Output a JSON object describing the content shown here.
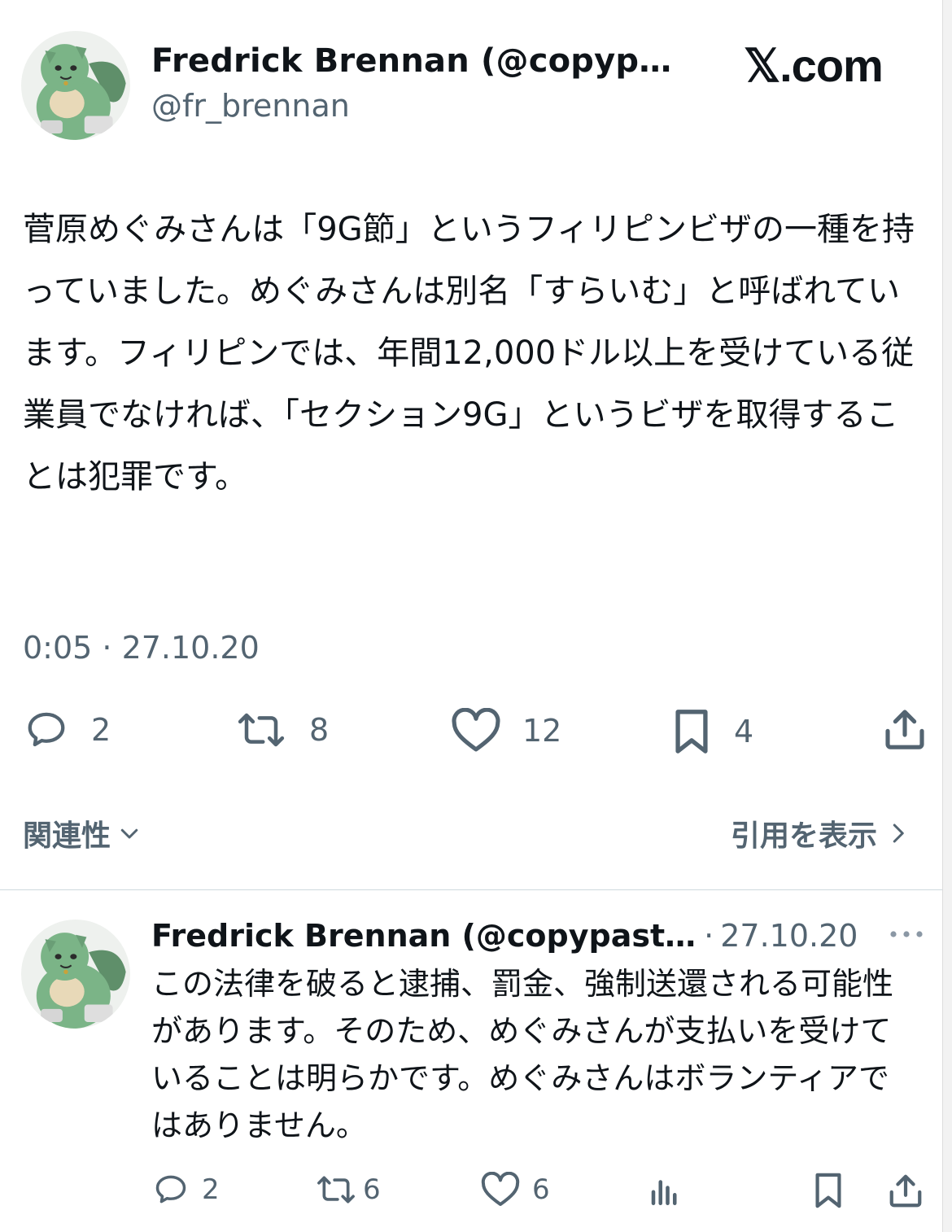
{
  "main_tweet": {
    "author_name": "Fredrick Brennan (@copyp…",
    "handle": "@fr_brennan",
    "brand": "𝕏.com",
    "text": "菅原めぐみさんは「9G節」というフィリピンビザの一種を持っていました。めぐみさんは別名「すらいむ」と呼ばれています。フィリピンでは、年間12,000ドル以上を受けている従業員でなければ、「セクション9G」というビザを取得することは犯罪です。",
    "timestamp": "0:05 · 27.10.20",
    "actions": {
      "replies": "2",
      "reposts": "8",
      "likes": "12",
      "bookmarks": "4"
    },
    "icons": [
      "reply-icon",
      "repost-icon",
      "like-icon",
      "bookmark-icon",
      "share-icon"
    ]
  },
  "footer": {
    "relevance_label": "関連性",
    "view_quotes_label": "引用を表示"
  },
  "reply_tweet": {
    "author_name": "Fredrick Brennan (@copypast…",
    "separator": "·",
    "date": "27.10.20",
    "text": "この法律を破ると逮捕、罰金、強制送還される可能性があります。そのため、めぐみさんが支払いを受けていることは明らかです。めぐみさんはボランティアではありません。",
    "actions": {
      "replies": "2",
      "reposts": "6",
      "likes": "6"
    },
    "icons": [
      "reply-icon",
      "repost-icon",
      "like-icon",
      "analytics-icon",
      "bookmark-icon",
      "share-icon",
      "more-icon"
    ]
  },
  "colors": {
    "text_primary": "#0f1419",
    "text_secondary": "#536471",
    "divider": "#cfd9de",
    "avatar_green": "#6fa878"
  }
}
